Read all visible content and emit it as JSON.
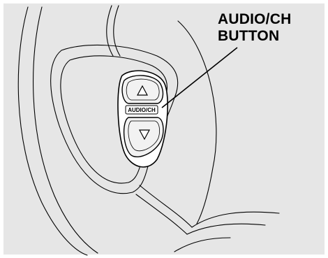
{
  "callout": {
    "line1": "AUDIO/CH",
    "line2": "BUTTON"
  },
  "button": {
    "label": "AUDIO/CH",
    "up_symbol": "△",
    "down_symbol": "▽"
  },
  "colors": {
    "background": "#e6e6e6",
    "stroke": "#000000",
    "panel_fill": "#f2f2f2"
  }
}
